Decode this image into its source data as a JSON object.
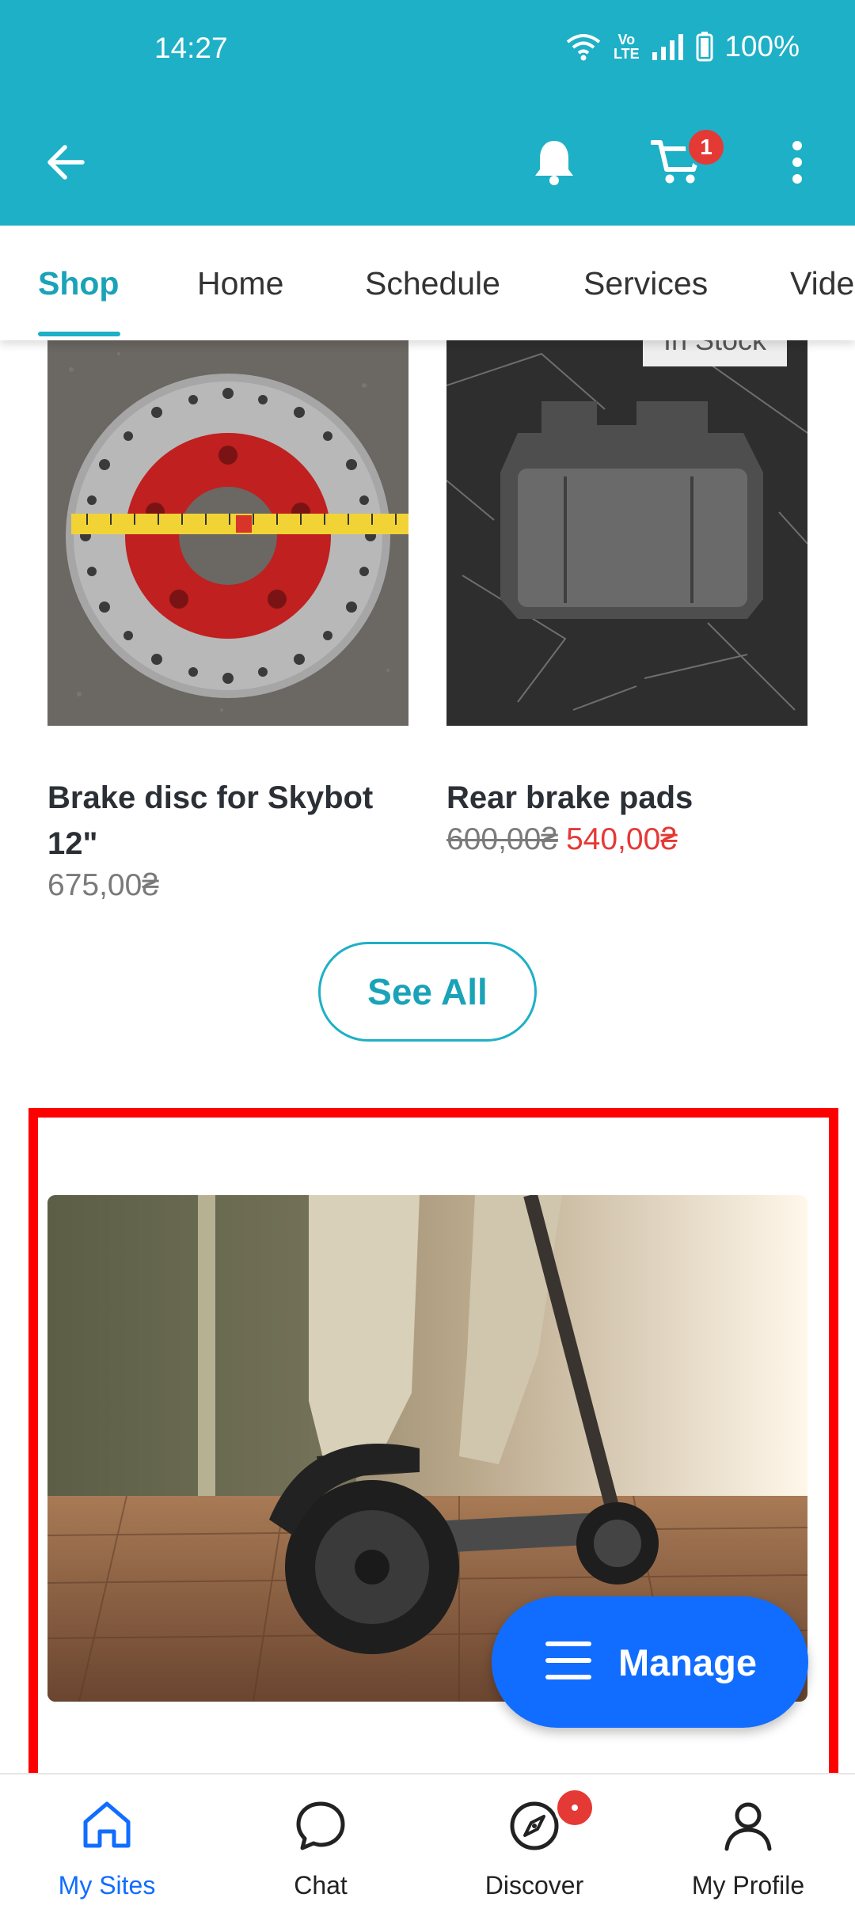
{
  "status_bar": {
    "time": "14:27",
    "battery": "100%",
    "network_label": "Vo LTE"
  },
  "toolbar": {
    "cart_count": "1"
  },
  "tabs": [
    {
      "label": "Shop",
      "active": true
    },
    {
      "label": "Home",
      "active": false
    },
    {
      "label": "Schedule",
      "active": false
    },
    {
      "label": "Services",
      "active": false
    },
    {
      "label": "Vide",
      "active": false
    }
  ],
  "products": [
    {
      "name": "Brake disc for Skybot 12\"",
      "price": "675,00₴"
    },
    {
      "name": "Rear brake pads",
      "old_price": "600,00₴",
      "new_price": "540,00₴",
      "badge": "In Stock"
    }
  ],
  "see_all_label": "See All",
  "fab": {
    "label": "Manage"
  },
  "bottom_nav": [
    {
      "label": "My Sites",
      "icon": "home-icon",
      "active": true
    },
    {
      "label": "Chat",
      "icon": "chat-icon",
      "active": false
    },
    {
      "label": "Discover",
      "icon": "compass-icon",
      "active": false,
      "badge": true
    },
    {
      "label": "My Profile",
      "icon": "profile-icon",
      "active": false
    }
  ],
  "colors": {
    "header": "#1eb0c6",
    "accent": "#116dff",
    "sale": "#e53935",
    "highlight": "#ff0000"
  }
}
